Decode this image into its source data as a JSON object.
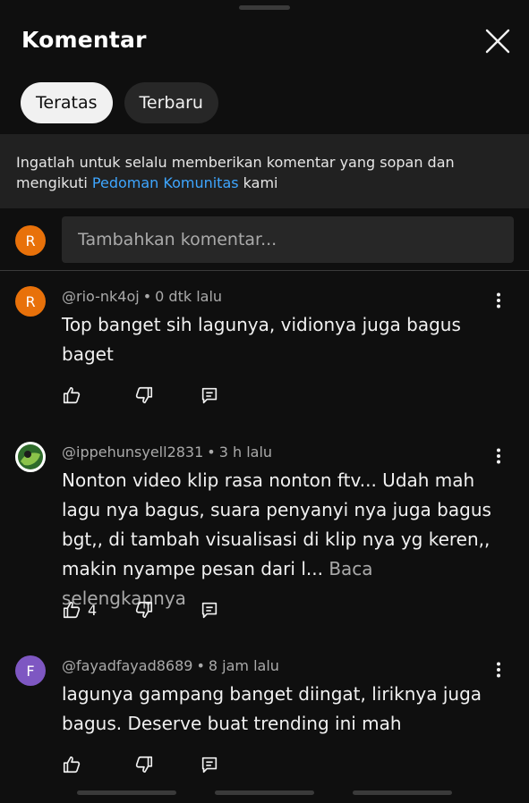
{
  "header": {
    "title": "Komentar",
    "close_icon": "close-icon"
  },
  "chips": [
    {
      "label": "Teratas",
      "active": true
    },
    {
      "label": "Terbaru",
      "active": false
    }
  ],
  "notice": {
    "text_before": "Ingatlah untuk selalu memberikan komentar yang sopan dan mengikuti ",
    "link_text": "Pedoman Komunitas",
    "text_after": " kami"
  },
  "add_comment": {
    "avatar_initial": "R",
    "avatar_color": "#e8710a",
    "placeholder": "Tambahkan komentar..."
  },
  "comments": [
    {
      "avatar_initial": "R",
      "avatar_color": "#e8710a",
      "author": "@rio-nk4oj",
      "time": "0 dtk lalu",
      "text": "Top banget sih lagunya, vidionya juga bagus baget",
      "read_more": "",
      "likes": ""
    },
    {
      "avatar_initial": "",
      "avatar_color": "#4a7a3a",
      "author": "@ippehunsyell2831",
      "time": "3 h lalu",
      "text": "Nonton video klip rasa nonton ftv... Udah mah lagu nya bagus, suara penyanyi nya juga bagus bgt,, di tambah visualisasi di klip nya yg keren,, makin nyampe pesan dari l...",
      "read_more": "Baca selengkapnya",
      "likes": "4"
    },
    {
      "avatar_initial": "F",
      "avatar_color": "#7e57c2",
      "author": "@fayadfayad8689",
      "time": "8 jam lalu",
      "text": "lagunya gampang banget diingat, liriknya juga bagus. Deserve buat trending ini mah",
      "read_more": "",
      "likes": ""
    }
  ],
  "icons": {
    "like": "thumbs-up-icon",
    "dislike": "thumbs-down-icon",
    "reply": "reply-icon",
    "menu": "more-vert-icon"
  }
}
